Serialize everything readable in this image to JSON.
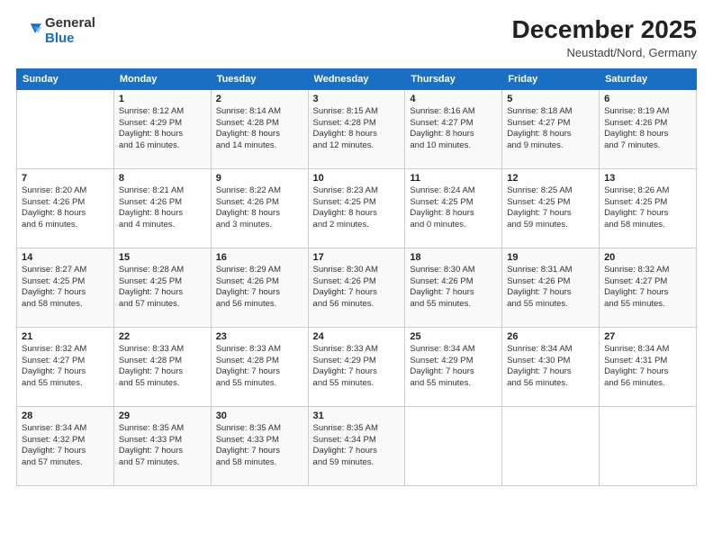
{
  "logo": {
    "general": "General",
    "blue": "Blue"
  },
  "header": {
    "month": "December 2025",
    "location": "Neustadt/Nord, Germany"
  },
  "days_header": [
    "Sunday",
    "Monday",
    "Tuesday",
    "Wednesday",
    "Thursday",
    "Friday",
    "Saturday"
  ],
  "weeks": [
    [
      {
        "num": "",
        "detail": ""
      },
      {
        "num": "1",
        "detail": "Sunrise: 8:12 AM\nSunset: 4:29 PM\nDaylight: 8 hours\nand 16 minutes."
      },
      {
        "num": "2",
        "detail": "Sunrise: 8:14 AM\nSunset: 4:28 PM\nDaylight: 8 hours\nand 14 minutes."
      },
      {
        "num": "3",
        "detail": "Sunrise: 8:15 AM\nSunset: 4:28 PM\nDaylight: 8 hours\nand 12 minutes."
      },
      {
        "num": "4",
        "detail": "Sunrise: 8:16 AM\nSunset: 4:27 PM\nDaylight: 8 hours\nand 10 minutes."
      },
      {
        "num": "5",
        "detail": "Sunrise: 8:18 AM\nSunset: 4:27 PM\nDaylight: 8 hours\nand 9 minutes."
      },
      {
        "num": "6",
        "detail": "Sunrise: 8:19 AM\nSunset: 4:26 PM\nDaylight: 8 hours\nand 7 minutes."
      }
    ],
    [
      {
        "num": "7",
        "detail": "Sunrise: 8:20 AM\nSunset: 4:26 PM\nDaylight: 8 hours\nand 6 minutes."
      },
      {
        "num": "8",
        "detail": "Sunrise: 8:21 AM\nSunset: 4:26 PM\nDaylight: 8 hours\nand 4 minutes."
      },
      {
        "num": "9",
        "detail": "Sunrise: 8:22 AM\nSunset: 4:26 PM\nDaylight: 8 hours\nand 3 minutes."
      },
      {
        "num": "10",
        "detail": "Sunrise: 8:23 AM\nSunset: 4:25 PM\nDaylight: 8 hours\nand 2 minutes."
      },
      {
        "num": "11",
        "detail": "Sunrise: 8:24 AM\nSunset: 4:25 PM\nDaylight: 8 hours\nand 0 minutes."
      },
      {
        "num": "12",
        "detail": "Sunrise: 8:25 AM\nSunset: 4:25 PM\nDaylight: 7 hours\nand 59 minutes."
      },
      {
        "num": "13",
        "detail": "Sunrise: 8:26 AM\nSunset: 4:25 PM\nDaylight: 7 hours\nand 58 minutes."
      }
    ],
    [
      {
        "num": "14",
        "detail": "Sunrise: 8:27 AM\nSunset: 4:25 PM\nDaylight: 7 hours\nand 58 minutes."
      },
      {
        "num": "15",
        "detail": "Sunrise: 8:28 AM\nSunset: 4:25 PM\nDaylight: 7 hours\nand 57 minutes."
      },
      {
        "num": "16",
        "detail": "Sunrise: 8:29 AM\nSunset: 4:26 PM\nDaylight: 7 hours\nand 56 minutes."
      },
      {
        "num": "17",
        "detail": "Sunrise: 8:30 AM\nSunset: 4:26 PM\nDaylight: 7 hours\nand 56 minutes."
      },
      {
        "num": "18",
        "detail": "Sunrise: 8:30 AM\nSunset: 4:26 PM\nDaylight: 7 hours\nand 55 minutes."
      },
      {
        "num": "19",
        "detail": "Sunrise: 8:31 AM\nSunset: 4:26 PM\nDaylight: 7 hours\nand 55 minutes."
      },
      {
        "num": "20",
        "detail": "Sunrise: 8:32 AM\nSunset: 4:27 PM\nDaylight: 7 hours\nand 55 minutes."
      }
    ],
    [
      {
        "num": "21",
        "detail": "Sunrise: 8:32 AM\nSunset: 4:27 PM\nDaylight: 7 hours\nand 55 minutes."
      },
      {
        "num": "22",
        "detail": "Sunrise: 8:33 AM\nSunset: 4:28 PM\nDaylight: 7 hours\nand 55 minutes."
      },
      {
        "num": "23",
        "detail": "Sunrise: 8:33 AM\nSunset: 4:28 PM\nDaylight: 7 hours\nand 55 minutes."
      },
      {
        "num": "24",
        "detail": "Sunrise: 8:33 AM\nSunset: 4:29 PM\nDaylight: 7 hours\nand 55 minutes."
      },
      {
        "num": "25",
        "detail": "Sunrise: 8:34 AM\nSunset: 4:29 PM\nDaylight: 7 hours\nand 55 minutes."
      },
      {
        "num": "26",
        "detail": "Sunrise: 8:34 AM\nSunset: 4:30 PM\nDaylight: 7 hours\nand 56 minutes."
      },
      {
        "num": "27",
        "detail": "Sunrise: 8:34 AM\nSunset: 4:31 PM\nDaylight: 7 hours\nand 56 minutes."
      }
    ],
    [
      {
        "num": "28",
        "detail": "Sunrise: 8:34 AM\nSunset: 4:32 PM\nDaylight: 7 hours\nand 57 minutes."
      },
      {
        "num": "29",
        "detail": "Sunrise: 8:35 AM\nSunset: 4:33 PM\nDaylight: 7 hours\nand 57 minutes."
      },
      {
        "num": "30",
        "detail": "Sunrise: 8:35 AM\nSunset: 4:33 PM\nDaylight: 7 hours\nand 58 minutes."
      },
      {
        "num": "31",
        "detail": "Sunrise: 8:35 AM\nSunset: 4:34 PM\nDaylight: 7 hours\nand 59 minutes."
      },
      {
        "num": "",
        "detail": ""
      },
      {
        "num": "",
        "detail": ""
      },
      {
        "num": "",
        "detail": ""
      }
    ]
  ]
}
